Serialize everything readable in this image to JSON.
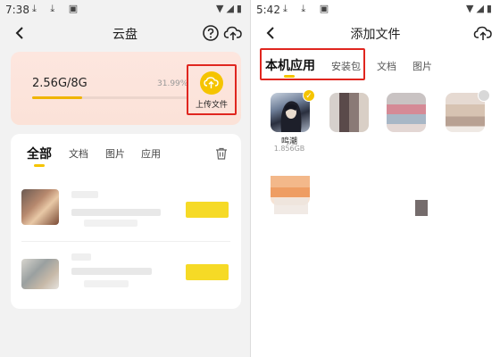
{
  "left": {
    "status": {
      "time": "7:38",
      "icons_left": "⤓ ⤓ ▣",
      "icons_right": "▼◢▮"
    },
    "title": "云盘",
    "storage": {
      "used_text": "2.56G/8G",
      "percent_text": "31.99%",
      "fraction": 0.3199
    },
    "upload_label": "上传文件",
    "tabs": [
      "全部",
      "文档",
      "图片",
      "应用"
    ],
    "active_tab": "全部",
    "icons": [
      "back-arrow-icon",
      "help-icon",
      "cloud-upload-icon",
      "trash-icon"
    ]
  },
  "right": {
    "status": {
      "time": "5:42",
      "icons_left": "⤓ ⤓ ▣",
      "icons_right": "▼◢▮"
    },
    "title": "添加文件",
    "tabs": [
      "本机应用",
      "安装包",
      "文档",
      "图片"
    ],
    "active_tab": "本机应用",
    "apps": [
      {
        "name": "鸣潮",
        "size": "1.856GB",
        "selected": true
      }
    ],
    "icons": [
      "back-arrow-icon",
      "cloud-upload-icon",
      "checkmark-icon"
    ]
  },
  "colors": {
    "accent": "#f5c400",
    "highlight": "#e0261f",
    "storage_card": "#fde6df"
  }
}
